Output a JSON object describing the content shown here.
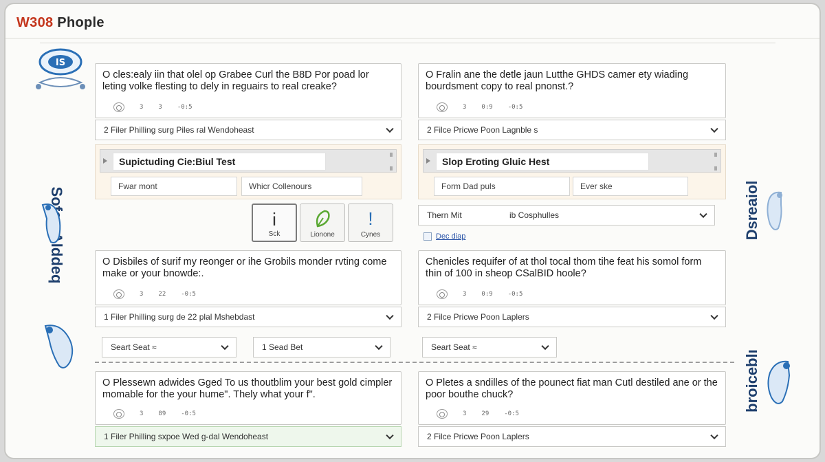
{
  "window": {
    "title_accent": "W308",
    "title_rest": " Phople"
  },
  "side": {
    "left_vertical": "Sofeo Alddeq",
    "right_top_vertical": "Dsreaiol",
    "right_bottom_vertical": "broiceblı"
  },
  "left_column": {
    "card1": {
      "question": "O cles:ealy iin that olel op Grabee Curl the B8D Por poad lor leting volke flesting to dely in reguairs to real creake?",
      "meta": [
        "3",
        "3",
        "-0:5"
      ]
    },
    "select1": "2  Filer Philling  surg Piles ral Wendoheast",
    "panel": {
      "title": "Supictuding Cie:Biul Test",
      "field1": "Fwar mont",
      "field2": "Whicr Collenours"
    },
    "tools": [
      {
        "glyph": "i",
        "label": "Sck"
      },
      {
        "glyph": "⊘",
        "label": "Lionone"
      },
      {
        "glyph": "!",
        "label": "Cynes"
      }
    ],
    "card2": {
      "question": "O Disbiles of surif my reonger or ihe Grobils monder rvting come make or your bnowde:.",
      "meta": [
        "3",
        "22",
        "-0:5"
      ]
    },
    "select2": "1  Filer Philling  surg de 22 plal Mshebdast",
    "dropdowns": [
      "Seart Seat ≈",
      "1  Sead Bet"
    ],
    "card3": {
      "question": "O Plessewn adwides Gged To us thoutblim your best gold cimpler momable for the your hume\". Thely what your f\".",
      "meta": [
        "3",
        "89",
        "-0:5"
      ]
    },
    "select3": "1  Filer Philling  sxpoe Wed g-dal Wendoheast"
  },
  "right_column": {
    "card1": {
      "question": "O Fralin ane the detle jaun Lutthe GHDS camer ety wiading bourdsment copy to real pnonst.?",
      "meta": [
        "3",
        "0:9",
        "-0:5"
      ]
    },
    "select1": "2  Filce Pricwe Poon Lagnble s",
    "panel": {
      "title": "Slop Eroting Gluic Hest",
      "field1": "Form Dad puls",
      "field2": "Ever ske"
    },
    "select_mid": {
      "left": "Thern Mit",
      "right": "ib Cosphulles"
    },
    "link": "Dec diap",
    "card2": {
      "question": "Chenicles requifer of at thol tocal thom tihe feat his somol form thin of 100 in sheop CSalBID hoole?",
      "meta": [
        "3",
        "0:9",
        "-0:5"
      ]
    },
    "select2": "2  Filce Pricwe Poon Laplers",
    "dropdown": "Seart Seat ≈",
    "card3": {
      "question": "O Pletes a sndilles of the pounect fiat man Cutl destiled ane or the poor bouthe chuck?",
      "meta": [
        "3",
        "29",
        "-0:5"
      ]
    },
    "select3": "2  Filce Pricwe Poon Laplers"
  },
  "colors": {
    "accent": "#c4361d",
    "side_text": "#1e3f6d",
    "panel_bg": "#fcf5ea",
    "link": "#2b55a8"
  }
}
